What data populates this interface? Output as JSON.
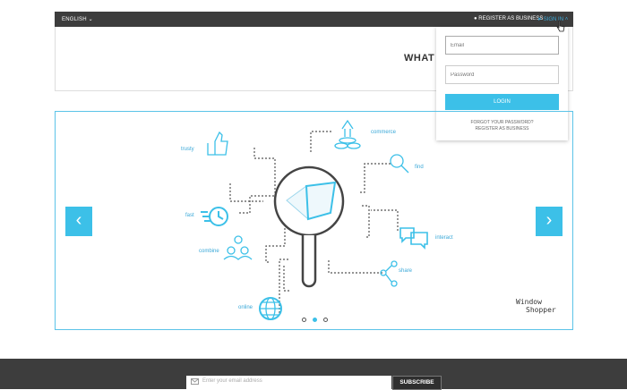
{
  "topbar": {
    "language": "ENGLISH",
    "register_business": "REGISTER AS BUSINESS",
    "sign_in": "SIGN IN"
  },
  "header": {
    "title_partial": "WHAT Y"
  },
  "login_dropdown": {
    "email_placeholder": "Email",
    "password_placeholder": "Password",
    "login_label": "LOGIN",
    "forgot_password": "FORGOT YOUR PASSWORD?",
    "register_business": "REGISTER AS BUSINESS"
  },
  "slider": {
    "labels": {
      "trusty": "trusty",
      "commerce": "commerce",
      "find": "find",
      "fast": "fast",
      "interact": "interact",
      "combine": "combine",
      "share": "share",
      "online": "online"
    },
    "prev_icon": "chevron-left-icon",
    "next_icon": "chevron-right-icon",
    "active_slide_index": 1,
    "slide_count": 3,
    "logo_text_line1": "Window",
    "logo_text_line2": "Shopper"
  },
  "footer": {
    "email_placeholder": "Enter your email address",
    "subscribe_label": "SUBSCRIBE"
  },
  "colors": {
    "accent": "#3cc0e8",
    "topbar_bg": "#3d3d3d",
    "footer_bg": "#3d3d3d"
  }
}
